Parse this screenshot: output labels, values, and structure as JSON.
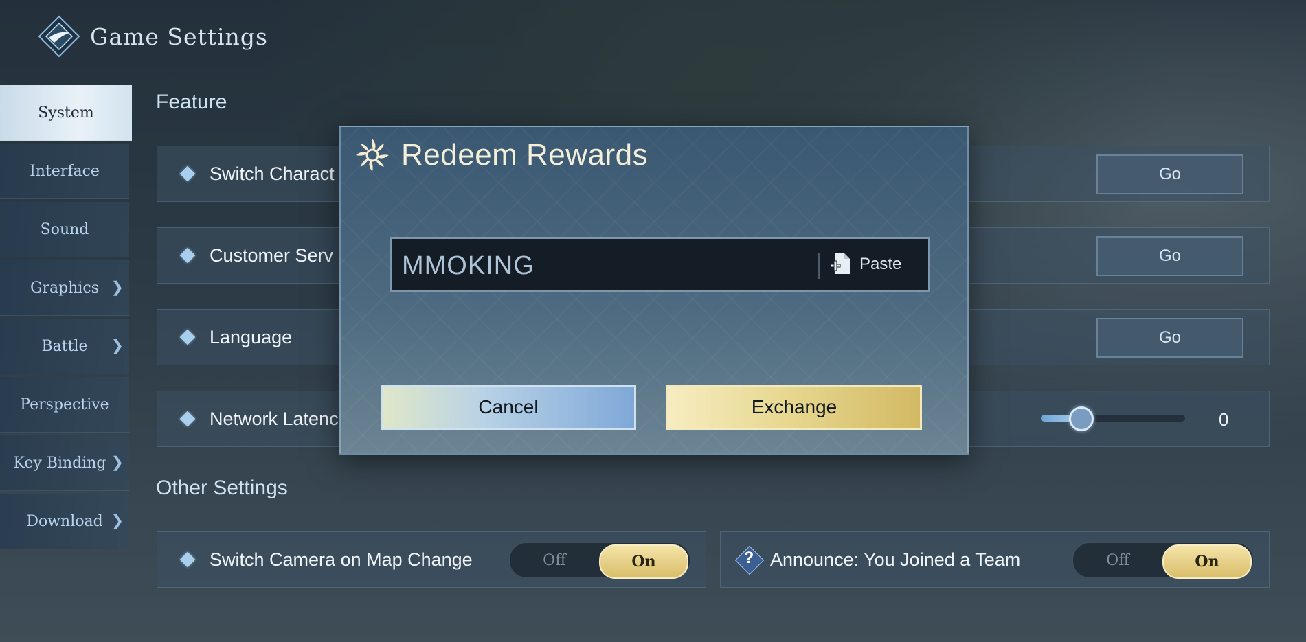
{
  "header": {
    "title": "Game Settings",
    "icon": "game-logo-icon"
  },
  "sidebar": {
    "items": [
      {
        "label": "System",
        "active": true,
        "chevron": false
      },
      {
        "label": "Interface",
        "active": false,
        "chevron": false
      },
      {
        "label": "Sound",
        "active": false,
        "chevron": false
      },
      {
        "label": "Graphics",
        "active": false,
        "chevron": true
      },
      {
        "label": "Battle",
        "active": false,
        "chevron": true
      },
      {
        "label": "Perspective",
        "active": false,
        "chevron": false
      },
      {
        "label": "Key Binding",
        "active": false,
        "chevron": true
      },
      {
        "label": "Download",
        "active": false,
        "chevron": true
      }
    ],
    "chevron_glyph": "❯"
  },
  "feature": {
    "title": "Feature",
    "rows": [
      {
        "label": "Switch Charact",
        "button": "Go"
      },
      {
        "label": "Customer Serv",
        "button": "Go"
      },
      {
        "label": "Language",
        "button": "Go"
      },
      {
        "label": "Network Latenc",
        "slider_value": "0",
        "slider_fraction": 0.28
      }
    ]
  },
  "other": {
    "title": "Other Settings",
    "rows": [
      {
        "label": "Switch Camera on Map Change",
        "off": "Off",
        "on": "On",
        "state": "On"
      },
      {
        "label": "Announce: You Joined a Team",
        "off": "Off",
        "on": "On",
        "state": "On",
        "icon": "help-icon"
      }
    ]
  },
  "modal": {
    "title": "Redeem Rewards",
    "icon": "reward-emblem-icon",
    "code_value": "MMOKING",
    "paste_label": "Paste",
    "cancel_label": "Cancel",
    "exchange_label": "Exchange"
  },
  "colors": {
    "accent_gold": "#e6d68d",
    "accent_blue": "#7fa8d8",
    "text_light": "#eef4f9"
  }
}
